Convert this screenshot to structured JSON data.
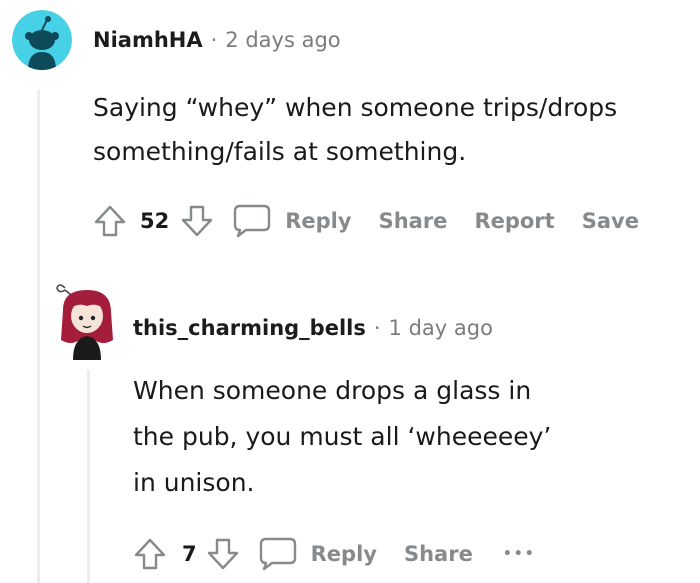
{
  "comment": {
    "author": "NiamhHA",
    "separator": "·",
    "timestamp": "2 days ago",
    "body_lines": [
      "Saying “whey” when someone trips/drops",
      "something/fails at something."
    ],
    "votes": "52",
    "actions": {
      "reply": "Reply",
      "share": "Share",
      "report": "Report",
      "save": "Save"
    },
    "avatar_color": "#46d1e6"
  },
  "reply": {
    "author": "this_charming_bells",
    "separator": "·",
    "timestamp": "1 day ago",
    "body_lines": [
      "When someone drops a glass in",
      "the pub, you must all ‘wheeeeey’",
      "in unison."
    ],
    "votes": "7",
    "actions": {
      "reply": "Reply",
      "share": "Share",
      "more": "•••"
    },
    "avatar_hair_color": "#a41e3b"
  },
  "colors": {
    "action_gray": "#878a8c",
    "meta_gray": "#7c7c7c",
    "thread_line": "#ededed"
  }
}
